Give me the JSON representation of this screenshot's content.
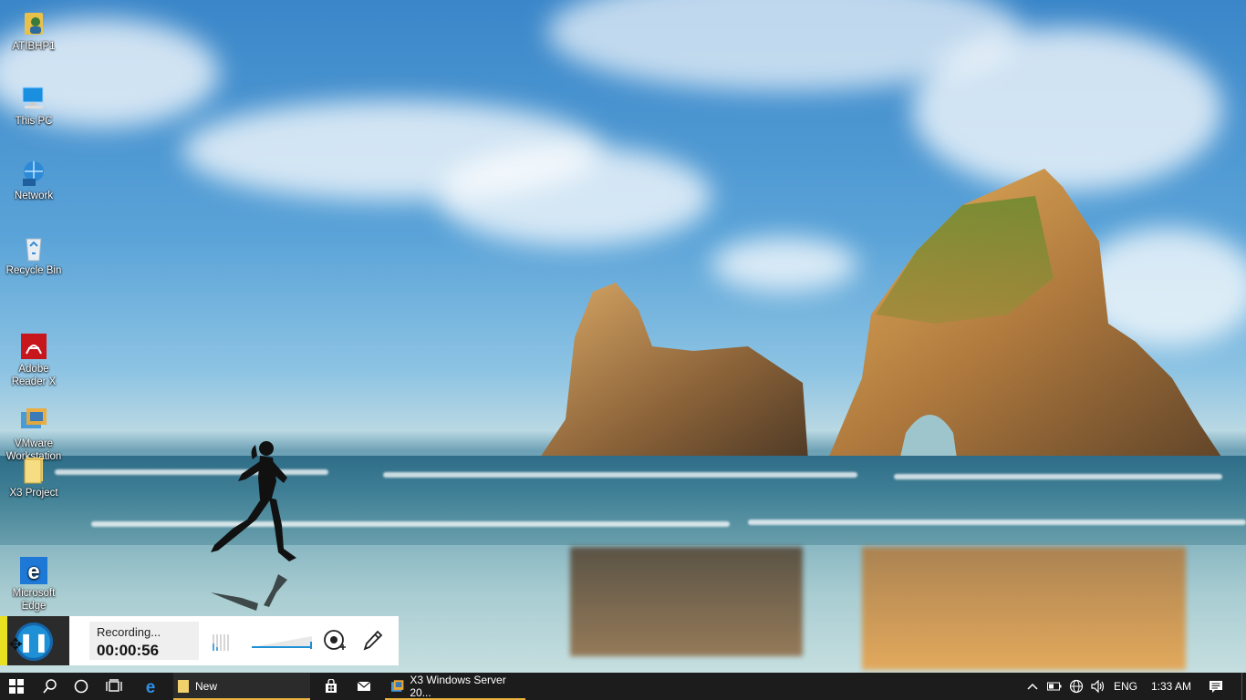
{
  "desktop": {
    "icons": [
      {
        "label": "ATIBHP1",
        "icon": "user-folder-icon"
      },
      {
        "label": "This PC",
        "icon": "computer-icon"
      },
      {
        "label": "Network",
        "icon": "network-icon"
      },
      {
        "label": "Recycle Bin",
        "icon": "recycle-bin-icon"
      },
      {
        "label": "Adobe\nReader X",
        "icon": "adobe-reader-icon"
      },
      {
        "label": "VMware\nWorkstation",
        "icon": "vmware-icon"
      },
      {
        "label": "X3 Project",
        "icon": "folder-icon"
      },
      {
        "label": "Microsoft\nEdge",
        "icon": "edge-icon"
      }
    ]
  },
  "recorder": {
    "status_label": "Recording...",
    "elapsed_time": "00:00:56"
  },
  "taskbar": {
    "tasks": [
      {
        "label": "New",
        "icon": "folder-icon"
      },
      {
        "label": "X3 Windows Server 20...",
        "icon": "vmware-icon"
      }
    ],
    "tray": {
      "language": "ENG",
      "time": "1:33 AM"
    }
  },
  "colors": {
    "taskbar_bg": "#1c1c1c",
    "recorder_accent": "#1e90d6",
    "recorder_yellow": "#e8e020",
    "active_task_underline": "#e8b33e",
    "vm_task_underline": "#e8b33e"
  }
}
